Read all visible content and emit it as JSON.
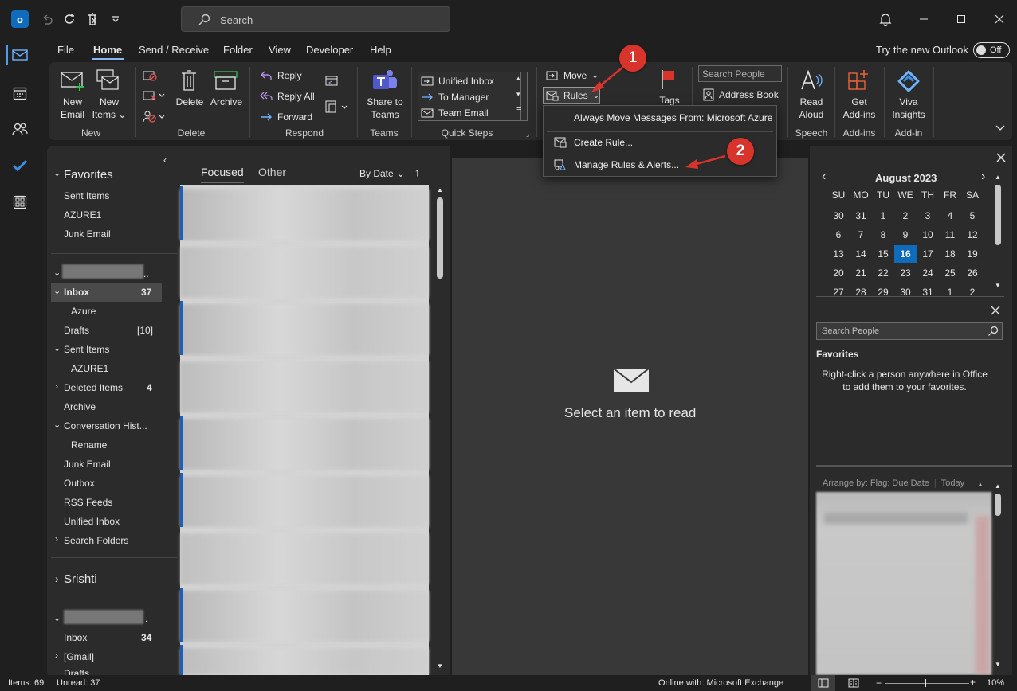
{
  "title_bar": {
    "search_placeholder": "Search"
  },
  "menu": {
    "tabs": [
      "File",
      "Home",
      "Send / Receive",
      "Folder",
      "View",
      "Developer",
      "Help"
    ],
    "try_new_label": "Try the new Outlook",
    "toggle_state": "Off"
  },
  "ribbon": {
    "new_email": [
      "New",
      "Email"
    ],
    "new_items": [
      "New",
      "Items"
    ],
    "delete": "Delete",
    "archive": "Archive",
    "reply": "Reply",
    "reply_all": "Reply All",
    "forward": "Forward",
    "share_teams": [
      "Share to",
      "Teams"
    ],
    "quick_steps": [
      "Unified Inbox",
      "To Manager",
      "Team Email"
    ],
    "move": "Move",
    "rules": "Rules",
    "tags": "Tags",
    "search_people_placeholder": "Search People",
    "address_book": "Address Book",
    "read_aloud": [
      "Read",
      "Aloud"
    ],
    "get_addins": [
      "Get",
      "Add-ins"
    ],
    "viva": [
      "Viva",
      "Insights"
    ],
    "groups": {
      "new": "New",
      "delete": "Delete",
      "respond": "Respond",
      "teams": "Teams",
      "quick_steps": "Quick Steps",
      "speech": "Speech",
      "addins1": "Add-ins",
      "addins2": "Add-in"
    }
  },
  "rules_menu": {
    "item1": "Always Move Messages From: Microsoft Azure",
    "item2": "Create Rule...",
    "item3": "Manage Rules & Alerts..."
  },
  "badges": {
    "one": "1",
    "two": "2"
  },
  "folders": {
    "favorites_title": "Favorites",
    "favorites": [
      "Sent Items",
      "AZURE1",
      "Junk Email"
    ],
    "account1_suffix": "..",
    "inbox": "Inbox",
    "inbox_count": "37",
    "items": [
      {
        "label": "Azure",
        "count": ""
      },
      {
        "label": "Drafts",
        "count": "[10]"
      },
      {
        "label": "Sent Items",
        "count": ""
      },
      {
        "label": "AZURE1",
        "count": ""
      },
      {
        "label": "Deleted Items",
        "count": "4"
      },
      {
        "label": "Archive",
        "count": ""
      },
      {
        "label": "Conversation Hist...",
        "count": ""
      },
      {
        "label": "Rename",
        "count": ""
      },
      {
        "label": "Junk Email",
        "count": ""
      },
      {
        "label": "Outbox",
        "count": ""
      },
      {
        "label": "RSS Feeds",
        "count": ""
      },
      {
        "label": "Unified Inbox",
        "count": ""
      },
      {
        "label": "Search Folders",
        "count": ""
      }
    ],
    "account2": "Srishti",
    "account3_suffix": ".",
    "inbox2": "Inbox",
    "inbox2_count": "34",
    "gmail": "[Gmail]",
    "drafts2": "Drafts"
  },
  "message_list": {
    "focused": "Focused",
    "other": "Other",
    "sort": "By Date"
  },
  "reading_pane": {
    "empty": "Select an item to read"
  },
  "calendar": {
    "month": "August 2023",
    "weekdays": [
      "SU",
      "MO",
      "TU",
      "WE",
      "TH",
      "FR",
      "SA"
    ],
    "weeks": [
      [
        "30",
        "31",
        "1",
        "2",
        "3",
        "4",
        "5"
      ],
      [
        "6",
        "7",
        "8",
        "9",
        "10",
        "11",
        "12"
      ],
      [
        "13",
        "14",
        "15",
        "16",
        "17",
        "18",
        "19"
      ],
      [
        "20",
        "21",
        "22",
        "23",
        "24",
        "25",
        "26"
      ],
      [
        "27",
        "28",
        "29",
        "30",
        "31",
        "1",
        "2"
      ]
    ],
    "today": "16"
  },
  "people": {
    "search_placeholder": "Search People",
    "favorites_title": "Favorites",
    "hint": "Right-click a person anywhere in Office to add them to your favorites."
  },
  "tasks": {
    "arrange": "Arrange by: Flag: Due Date",
    "today": "Today"
  },
  "status": {
    "items": "Items: 69",
    "unread": "Unread: 37",
    "connection": "Online with: Microsoft Exchange",
    "zoom": "10%"
  }
}
